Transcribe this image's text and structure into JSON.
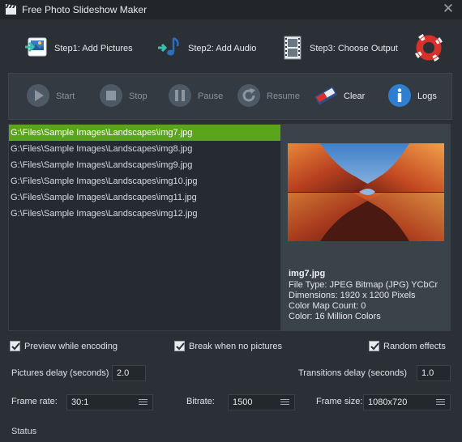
{
  "window": {
    "title": "Free Photo Slideshow Maker",
    "close_glyph": "✕"
  },
  "steps": [
    {
      "label": "Step1: Add Pictures",
      "icon": "add-pictures-icon"
    },
    {
      "label": "Step2: Add Audio",
      "icon": "add-audio-icon"
    },
    {
      "label": "Step3: Choose Output",
      "icon": "film-strip-icon"
    }
  ],
  "help_icon": "lifebuoy-icon",
  "toolbar": {
    "start": "Start",
    "stop": "Stop",
    "pause": "Pause",
    "resume": "Resume",
    "clear": "Clear",
    "logs": "Logs"
  },
  "files": [
    "G:\\Files\\Sample Images\\Landscapes\\img7.jpg",
    "G:\\Files\\Sample Images\\Landscapes\\img8.jpg",
    "G:\\Files\\Sample Images\\Landscapes\\img9.jpg",
    "G:\\Files\\Sample Images\\Landscapes\\img10.jpg",
    "G:\\Files\\Sample Images\\Landscapes\\img11.jpg",
    "G:\\Files\\Sample Images\\Landscapes\\img12.jpg"
  ],
  "selected_file_index": 0,
  "preview": {
    "name": "img7.jpg",
    "file_type": "File Type: JPEG Bitmap (JPG) YCbCr",
    "dimensions": "Dimensions: 1920 x 1200 Pixels",
    "color_map": "Color Map Count: 0",
    "color": "Color: 16 Million Colors"
  },
  "options": {
    "preview_while_encoding": {
      "label": "Preview while encoding",
      "checked": true
    },
    "break_when_no_pictures": {
      "label": "Break when no pictures",
      "checked": true
    },
    "random_effects": {
      "label": "Random effects",
      "checked": true
    }
  },
  "delays": {
    "pictures_label": "Pictures delay (seconds)",
    "pictures_value": "2.0",
    "transitions_label": "Transitions delay (seconds)",
    "transitions_value": "1.0"
  },
  "encoding": {
    "frame_rate_label": "Frame rate:",
    "frame_rate_value": "30:1",
    "bitrate_label": "Bitrate:",
    "bitrate_value": "1500",
    "frame_size_label": "Frame size:",
    "frame_size_value": "1080x720"
  },
  "status": "Status",
  "colors": {
    "accent_selected": "#5aa51b",
    "background": "#2b3036",
    "disabled_icon": "#4d5a66",
    "info_blue": "#2f7fd0"
  }
}
